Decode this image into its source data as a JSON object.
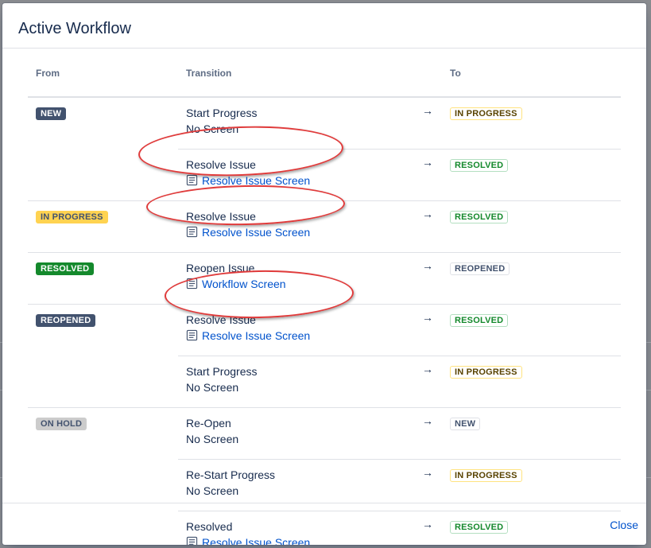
{
  "dialog": {
    "title": "Active Workflow",
    "close_label": "Close"
  },
  "table": {
    "headers": {
      "from": "From",
      "transition": "Transition",
      "to": "To"
    },
    "arrow": "→",
    "groups": [
      {
        "from": {
          "label": "NEW",
          "style": "loz-solid-blue"
        },
        "rows": [
          {
            "transition": "Start Progress",
            "screen": "No Screen",
            "screen_is_link": false,
            "to": {
              "label": "IN PROGRESS",
              "style": "loz-sub-yellow"
            }
          },
          {
            "transition": "Resolve Issue",
            "screen": "Resolve Issue Screen",
            "screen_is_link": true,
            "to": {
              "label": "RESOLVED",
              "style": "loz-sub-green"
            }
          }
        ]
      },
      {
        "from": {
          "label": "IN PROGRESS",
          "style": "loz-solid-yellow"
        },
        "rows": [
          {
            "transition": "Resolve Issue",
            "screen": "Resolve Issue Screen",
            "screen_is_link": true,
            "to": {
              "label": "RESOLVED",
              "style": "loz-sub-green"
            }
          }
        ]
      },
      {
        "from": {
          "label": "RESOLVED",
          "style": "loz-solid-green"
        },
        "rows": [
          {
            "transition": "Reopen Issue",
            "screen": "Workflow Screen",
            "screen_is_link": true,
            "to": {
              "label": "REOPENED",
              "style": "loz-sub-gray"
            }
          }
        ]
      },
      {
        "from": {
          "label": "REOPENED",
          "style": "loz-solid-blue"
        },
        "rows": [
          {
            "transition": "Resolve Issue",
            "screen": "Resolve Issue Screen",
            "screen_is_link": true,
            "to": {
              "label": "RESOLVED",
              "style": "loz-sub-green"
            }
          },
          {
            "transition": "Start Progress",
            "screen": "No Screen",
            "screen_is_link": false,
            "to": {
              "label": "IN PROGRESS",
              "style": "loz-sub-yellow"
            }
          }
        ]
      },
      {
        "from": {
          "label": "ON HOLD",
          "style": "loz-solid-gray"
        },
        "rows": [
          {
            "transition": "Re-Open",
            "screen": "No Screen",
            "screen_is_link": false,
            "to": {
              "label": "NEW",
              "style": "loz-sub-blue"
            }
          },
          {
            "transition": "Re-Start Progress",
            "screen": "No Screen",
            "screen_is_link": false,
            "to": {
              "label": "IN PROGRESS",
              "style": "loz-sub-yellow"
            }
          },
          {
            "transition": "Resolved",
            "screen": "Resolve Issue Screen",
            "screen_is_link": true,
            "to": {
              "label": "RESOLVED",
              "style": "loz-sub-green"
            }
          }
        ]
      }
    ]
  },
  "icons": {
    "screen": "screen-form-icon",
    "arrow": "right-arrow-glyph"
  },
  "colors": {
    "link": "#0052cc",
    "annotation": "#e03b3b"
  }
}
